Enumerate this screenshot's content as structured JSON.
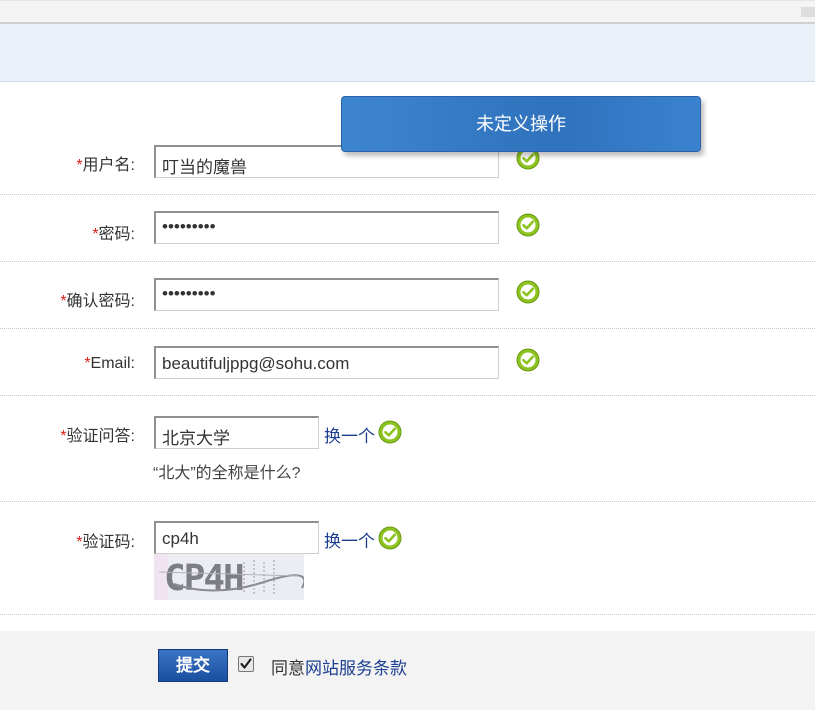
{
  "form": {
    "required_mark": "*",
    "username": {
      "label": "用户名:",
      "value": "叮当的魔兽"
    },
    "password": {
      "label": "密码:",
      "value": "•••••••••"
    },
    "confirm_password": {
      "label": "确认密码:",
      "value": "•••••••••"
    },
    "email": {
      "label": "Email:",
      "value": "beautifuljppg@sohu.com"
    },
    "question": {
      "label": "验证问答:",
      "value": "北京大学",
      "change_label": "换一个",
      "hint": "“北大”的全称是什么?"
    },
    "captcha": {
      "label": "验证码:",
      "value": "cp4h",
      "change_label": "换一个",
      "image_text": "CP4H"
    }
  },
  "footer": {
    "submit_label": "提交",
    "agree_prefix": "同意",
    "terms_link": "网站服务条款"
  },
  "popup": {
    "label": "未定义操作"
  },
  "colors": {
    "accent": "#2f72bd",
    "required": "#e02020",
    "ok": "#8cc31f",
    "link": "#1d3f91"
  }
}
